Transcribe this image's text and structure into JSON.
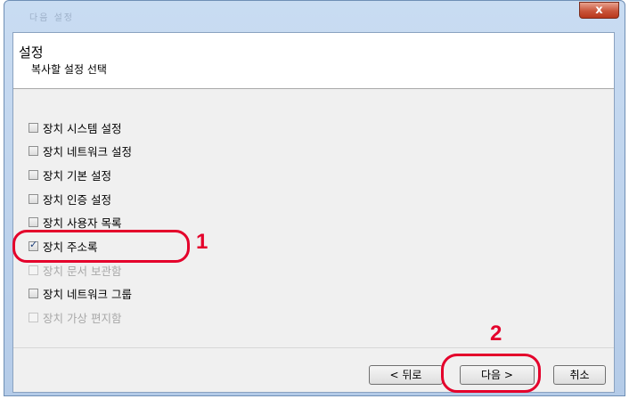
{
  "window": {
    "title": "다음 설정",
    "close_label": "x"
  },
  "header": {
    "title": "설정",
    "subtitle": "복사할 설정 선택"
  },
  "options": [
    {
      "label": "장치 시스템 설정",
      "checked": false,
      "enabled": true
    },
    {
      "label": "장치 네트워크 설정",
      "checked": false,
      "enabled": true
    },
    {
      "label": "장치 기본 설정",
      "checked": false,
      "enabled": true
    },
    {
      "label": "장치 인증 설정",
      "checked": false,
      "enabled": true
    },
    {
      "label": "장치 사용자 목록",
      "checked": false,
      "enabled": true
    },
    {
      "label": "장치 주소록",
      "checked": true,
      "enabled": true
    },
    {
      "label": "장치 문서 보관함",
      "checked": false,
      "enabled": false
    },
    {
      "label": "장치 네트워크 그룹",
      "checked": false,
      "enabled": true
    },
    {
      "label": "장치 가상 편지함",
      "checked": false,
      "enabled": false
    }
  ],
  "buttons": {
    "back": "< 뒤로",
    "next": "다음 >",
    "cancel": "취소"
  },
  "annotations": {
    "step1": "1",
    "step2": "2"
  },
  "colors": {
    "annotation": "#e4002b",
    "title_bar": "#c9dcf2",
    "close_button": "#c9553b"
  }
}
